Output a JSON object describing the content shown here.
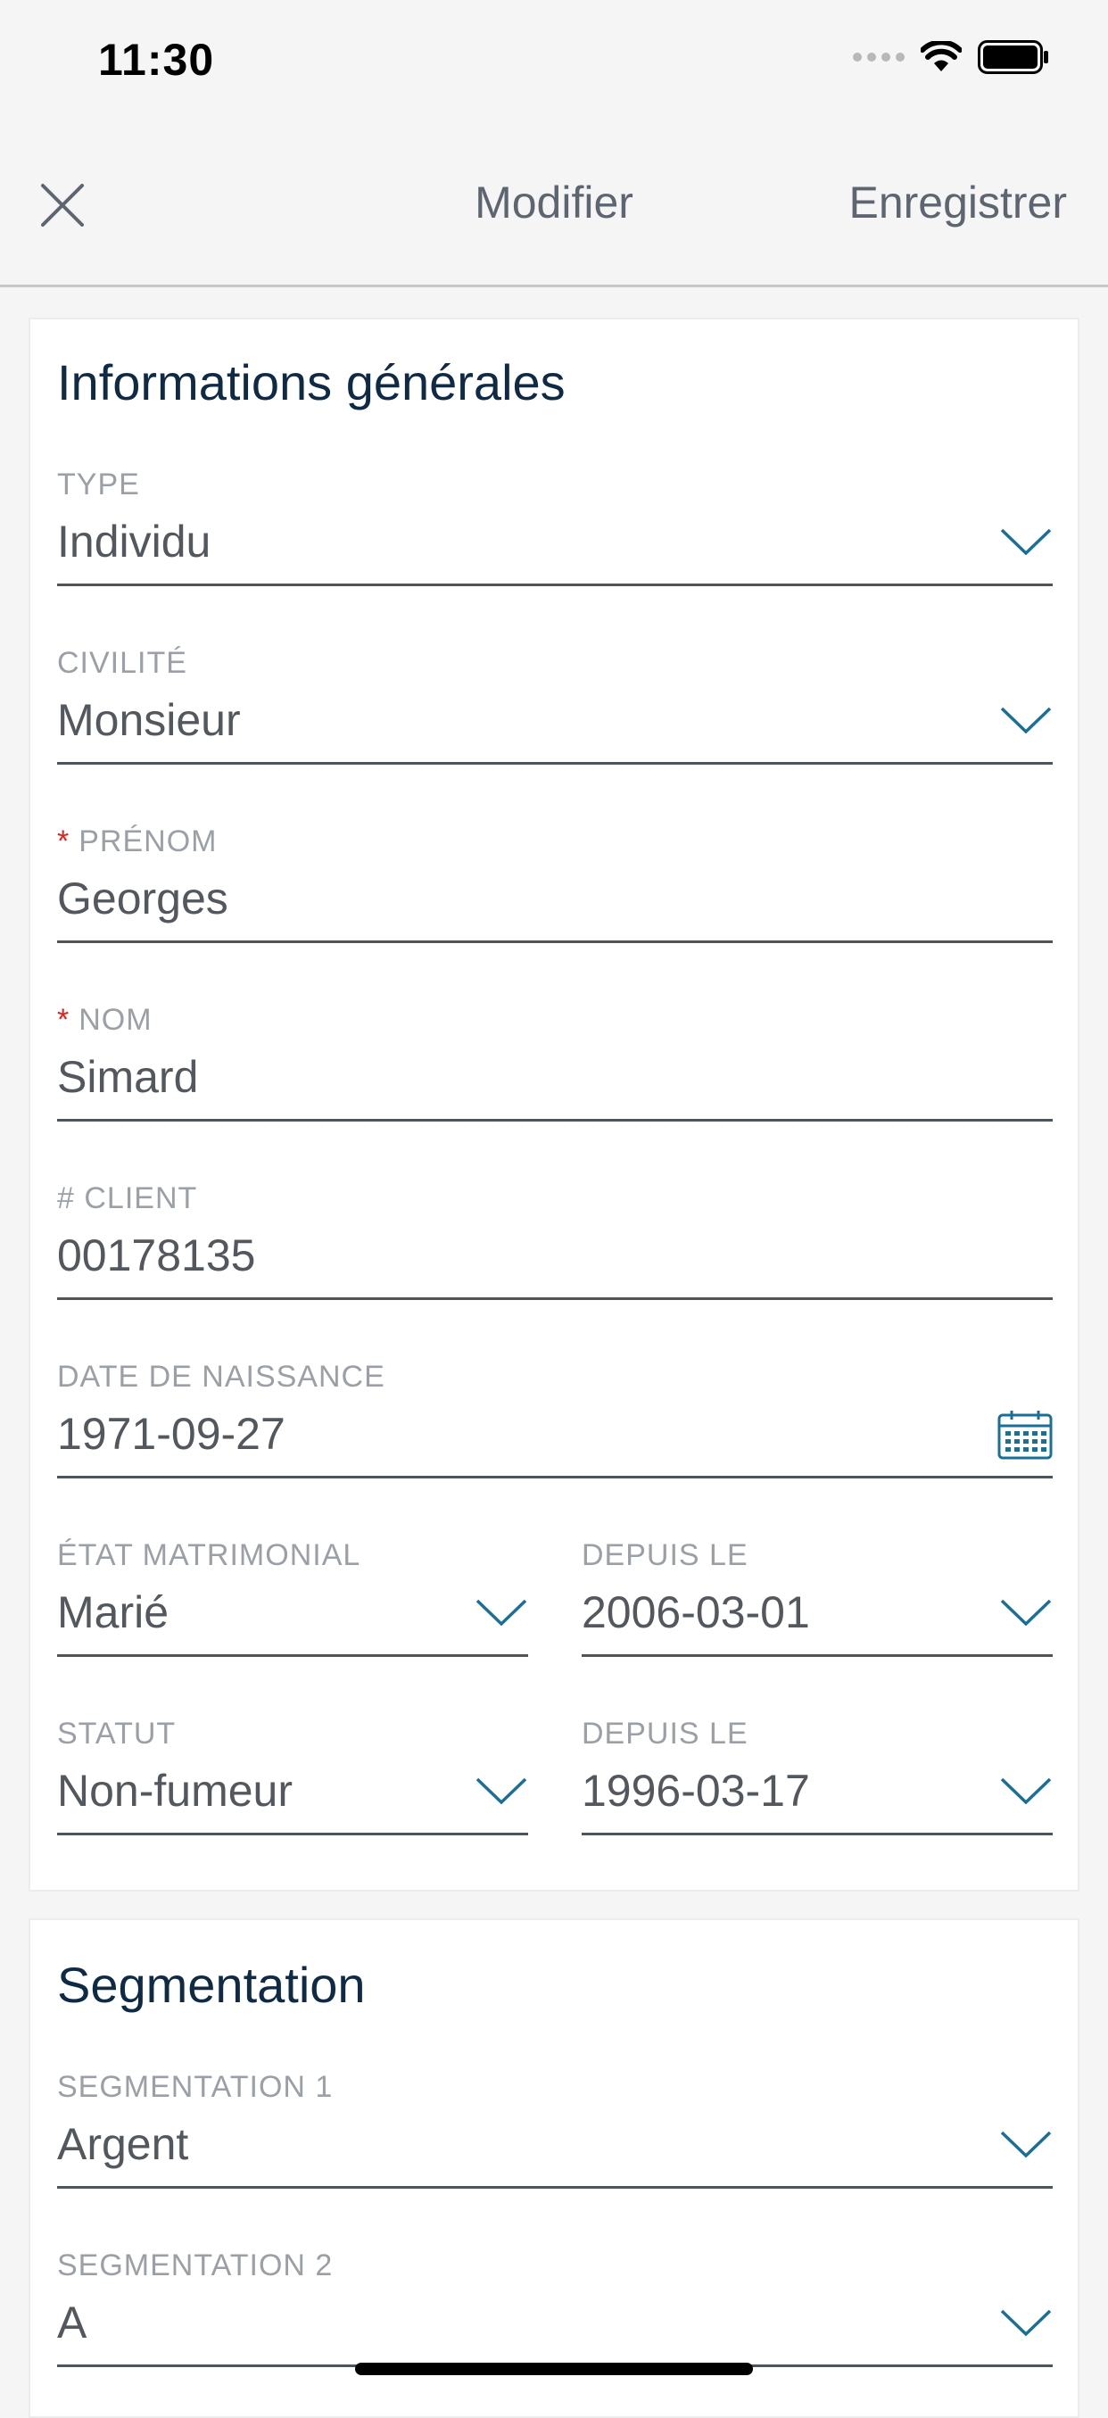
{
  "status_bar": {
    "time": "11:30"
  },
  "nav": {
    "title": "Modifier",
    "save_label": "Enregistrer"
  },
  "general": {
    "title": "Informations générales",
    "type": {
      "label": "TYPE",
      "value": "Individu"
    },
    "civility": {
      "label": "CIVILITÉ",
      "value": "Monsieur"
    },
    "first_name": {
      "required_mark": "*",
      "label": "PRÉNOM",
      "value": "Georges"
    },
    "last_name": {
      "required_mark": "*",
      "label": "NOM",
      "value": "Simard"
    },
    "client_number": {
      "label": "# CLIENT",
      "value": "00178135"
    },
    "birth_date": {
      "label": "DATE DE NAISSANCE",
      "value": "1971-09-27"
    },
    "marital_status": {
      "label": "ÉTAT MATRIMONIAL",
      "value": "Marié"
    },
    "marital_since": {
      "label": "DEPUIS LE",
      "value": "2006-03-01"
    },
    "status": {
      "label": "STATUT",
      "value": "Non-fumeur"
    },
    "status_since": {
      "label": "DEPUIS LE",
      "value": "1996-03-17"
    }
  },
  "segmentation": {
    "title": "Segmentation",
    "segment1": {
      "label": "SEGMENTATION 1",
      "value": "Argent"
    },
    "segment2": {
      "label": "SEGMENTATION 2",
      "value": "A"
    }
  },
  "colors": {
    "accent": "#1b6f97",
    "required": "#e0201b",
    "title": "#0f2a44",
    "label": "#9aa0a6",
    "value": "#52585e"
  },
  "icons": {
    "close": "close-icon",
    "dropdown": "chevron-down-icon",
    "calendar": "calendar-icon",
    "wifi": "wifi-icon",
    "battery": "battery-icon",
    "signal": "signal-icon"
  }
}
